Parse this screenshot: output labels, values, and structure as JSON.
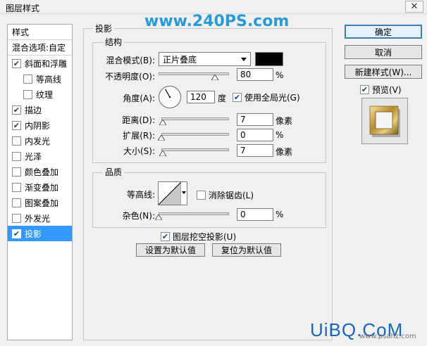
{
  "window": {
    "title": "图层样式",
    "close_glyph": "✕"
  },
  "sidebar": {
    "header": "样式",
    "blend_options": "混合选项:自定",
    "items": [
      {
        "label": "斜面和浮雕",
        "checked": true
      },
      {
        "label": "等高线",
        "checked": false
      },
      {
        "label": "纹理",
        "checked": false
      },
      {
        "label": "描边",
        "checked": true
      },
      {
        "label": "内阴影",
        "checked": true
      },
      {
        "label": "内发光",
        "checked": false
      },
      {
        "label": "光泽",
        "checked": false
      },
      {
        "label": "颜色叠加",
        "checked": false
      },
      {
        "label": "渐变叠加",
        "checked": false
      },
      {
        "label": "图案叠加",
        "checked": false
      },
      {
        "label": "外发光",
        "checked": false
      },
      {
        "label": "投影",
        "checked": true,
        "selected": true
      }
    ]
  },
  "panel": {
    "title": "投影",
    "structure": {
      "title": "结构",
      "blend_mode_label": "混合模式(B):",
      "blend_mode_value": "正片叠底",
      "shadow_color": "#000000",
      "opacity_label": "不透明度(O):",
      "opacity_value": "80",
      "opacity_unit": "%",
      "opacity_fraction": 0.8,
      "angle_label": "角度(A):",
      "angle_value": "120",
      "angle_unit": "度",
      "global_light_label": "使用全局光(G)",
      "global_light_checked": true,
      "distance_label": "距离(D):",
      "distance_value": "7",
      "distance_unit": "像素",
      "distance_fraction": 0.025,
      "spread_label": "扩展(R):",
      "spread_value": "0",
      "spread_unit": "%",
      "spread_fraction": 0.0,
      "size_label": "大小(S):",
      "size_value": "7",
      "size_unit": "像素",
      "size_fraction": 0.025
    },
    "quality": {
      "title": "品质",
      "contour_label": "等高线:",
      "anti_alias_label": "消除锯齿(L)",
      "anti_alias_checked": false,
      "noise_label": "杂色(N):",
      "noise_value": "0",
      "noise_unit": "%",
      "noise_fraction": 0.0
    },
    "knockout_label": "图层挖空投影(U)",
    "knockout_checked": true,
    "make_default": "设置为默认值",
    "reset_default": "复位为默认值"
  },
  "buttons": {
    "ok": "确定",
    "cancel": "取消",
    "new_style": "新建样式(W)...",
    "preview_label": "预览(V)",
    "preview_checked": true
  },
  "watermarks": {
    "top": "www.240PS.com",
    "bottom": "UiBQ.CoM",
    "url": "www.psahz.com"
  }
}
